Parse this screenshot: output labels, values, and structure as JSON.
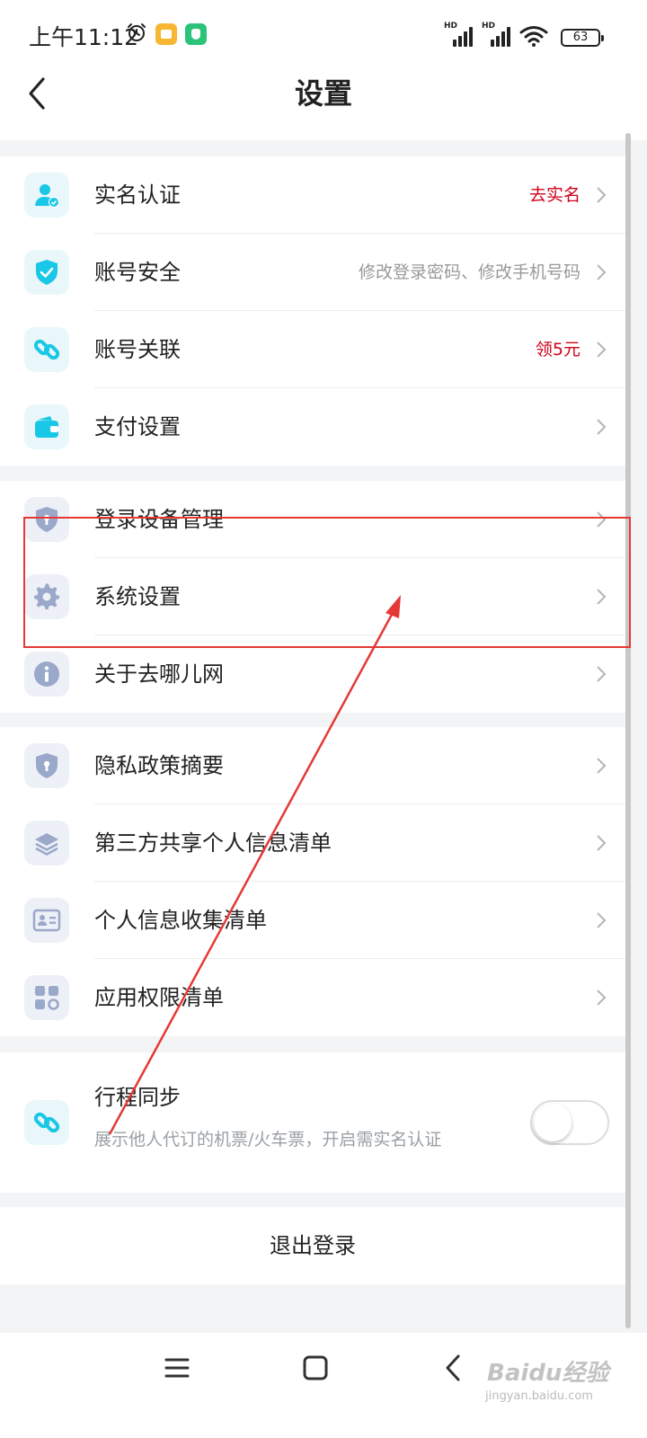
{
  "status_bar": {
    "time": "上午11:12",
    "battery": "63",
    "network_label": "HD"
  },
  "header": {
    "title": "设置"
  },
  "groups": [
    {
      "items": [
        {
          "label": "实名认证",
          "value": "去实名",
          "icon": "user-verify-icon"
        },
        {
          "label": "账号安全",
          "value": "修改登录密码、修改手机号码",
          "icon": "shield-check-icon"
        },
        {
          "label": "账号关联",
          "value": "领5元",
          "icon": "link-icon"
        },
        {
          "label": "支付设置",
          "value": "",
          "icon": "wallet-icon"
        }
      ]
    },
    {
      "items": [
        {
          "label": "登录设备管理",
          "value": "",
          "icon": "shield-lock-icon"
        },
        {
          "label": "系统设置",
          "value": "",
          "icon": "gear-icon"
        },
        {
          "label": "关于去哪儿网",
          "value": "",
          "icon": "info-icon"
        }
      ]
    },
    {
      "items": [
        {
          "label": "隐私政策摘要",
          "value": "",
          "icon": "shield-lock-icon"
        },
        {
          "label": "第三方共享个人信息清单",
          "value": "",
          "icon": "layers-icon"
        },
        {
          "label": "个人信息收集清单",
          "value": "",
          "icon": "id-card-icon"
        },
        {
          "label": "应用权限清单",
          "value": "",
          "icon": "apps-icon"
        }
      ]
    }
  ],
  "trip_sync": {
    "title": "行程同步",
    "subtitle": "展示他人代订的机票/火车票，开启需实名认证",
    "enabled": false
  },
  "logout": {
    "label": "退出登录"
  },
  "watermark": {
    "text": "Baidu经验",
    "sub": "jingyan.baidu.com"
  },
  "colors": {
    "accent": "#19c7e6",
    "highlight_red": "#d0021b",
    "annotation": "#e53935"
  }
}
